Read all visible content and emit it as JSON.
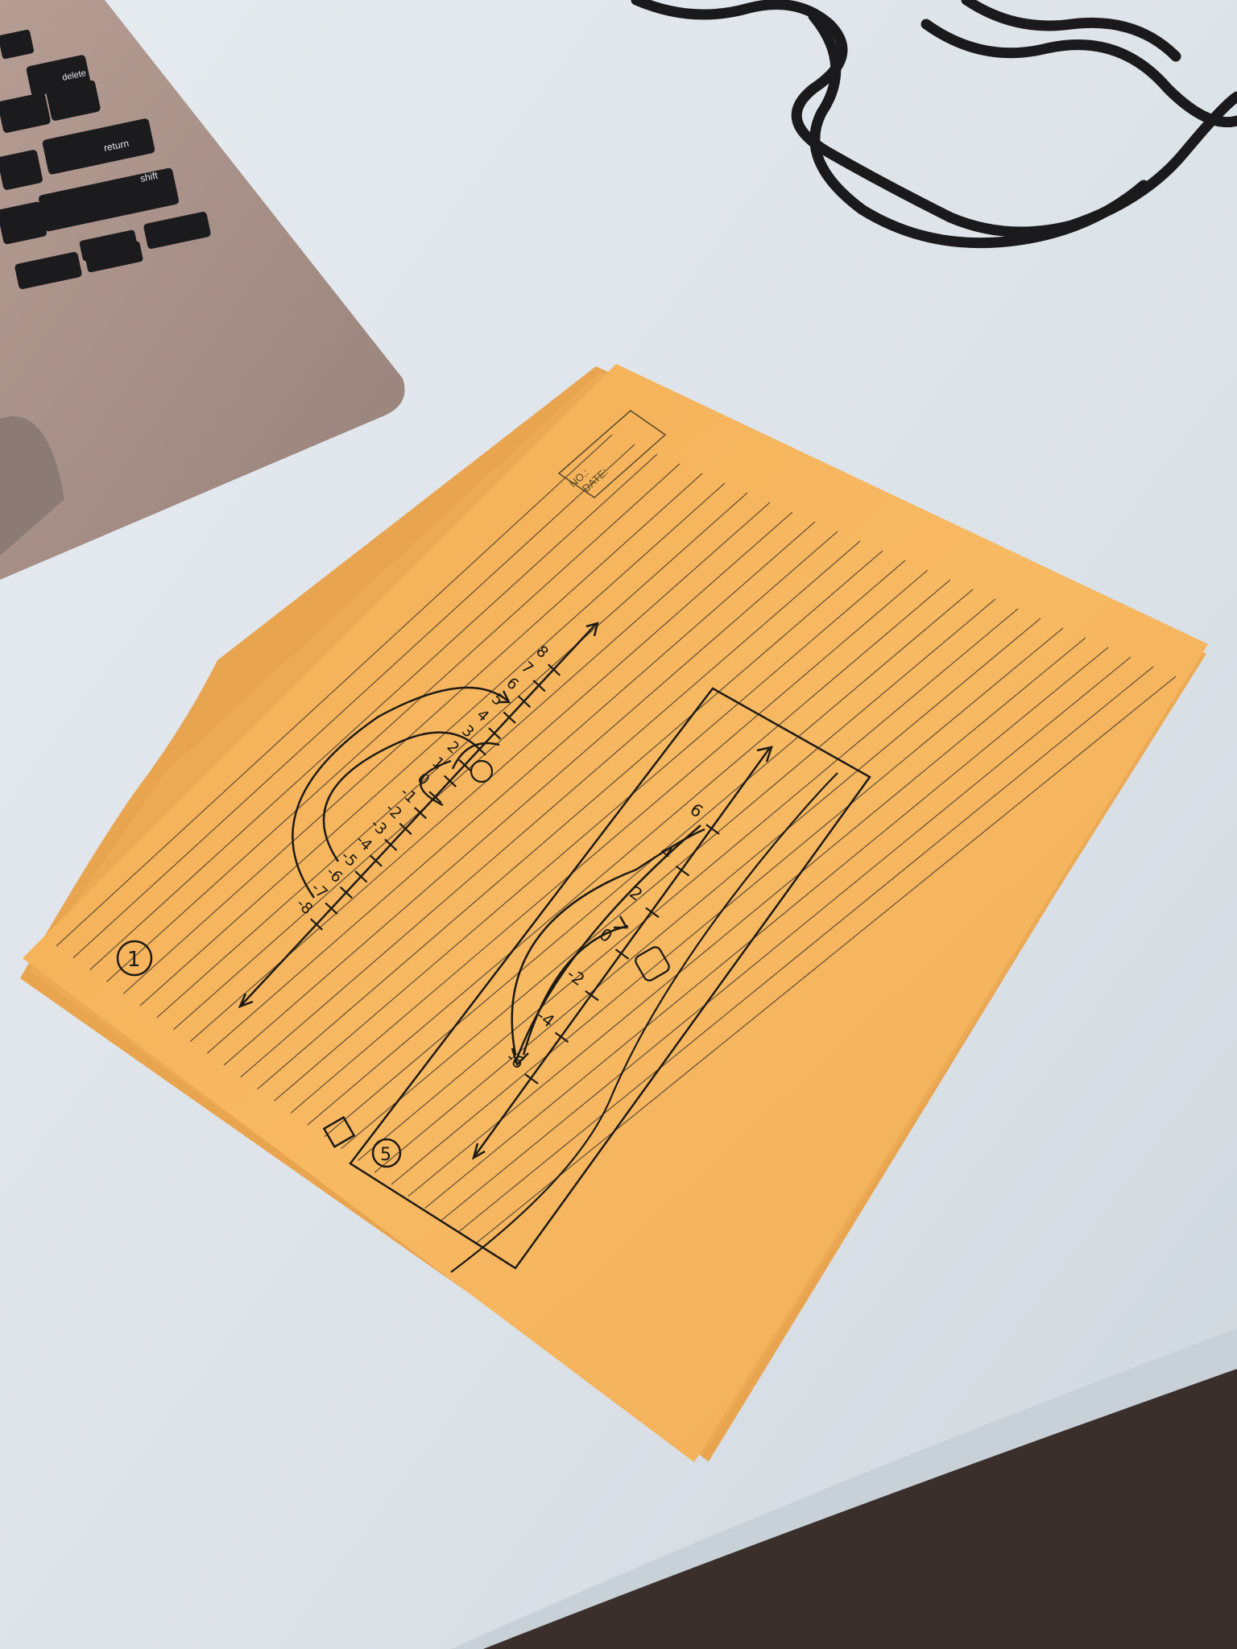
{
  "laptop": {
    "keys": {
      "delete": "delete",
      "return": "return",
      "shift": "shift"
    },
    "colors": {
      "body": "#a48d84",
      "keys": "#1b1b1d"
    }
  },
  "paper": {
    "colors": {
      "paper": "#f6b55a",
      "lines": "#3d3328",
      "ink": "#1d1a14"
    },
    "header_box": {
      "no_label": "NO.:",
      "date_label": "DATE:"
    },
    "problem_1": {
      "number": "1",
      "tick_labels": [
        "-8",
        "-7",
        "-6",
        "-5",
        "-4",
        "-3",
        "-2",
        "-1",
        "0",
        "1",
        "2",
        "3",
        "4",
        "5",
        "6",
        "7",
        "8"
      ],
      "circled_label": "2"
    },
    "problem_5": {
      "number": "5",
      "tick_labels": [
        "-6",
        "-4",
        "-2",
        "0",
        "2",
        "4",
        "6"
      ],
      "boxed_label": "0"
    }
  }
}
